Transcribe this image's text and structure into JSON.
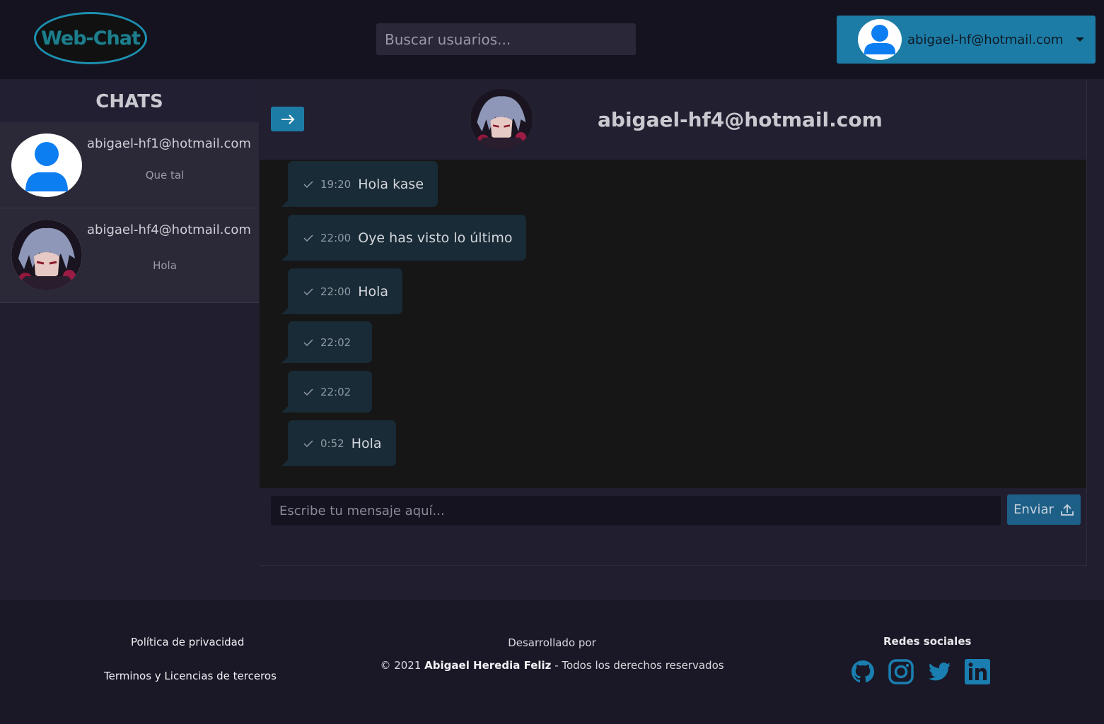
{
  "header": {
    "logo_text": "Web-Chat",
    "search_placeholder": "Buscar usuarios...",
    "account_email": "abigael-hf@hotmail.com"
  },
  "sidebar": {
    "title": "CHATS",
    "chats": [
      {
        "email": "abigael-hf1@hotmail.com",
        "last_message": "Que tal",
        "avatar": "default-user"
      },
      {
        "email": "abigael-hf4@hotmail.com",
        "last_message": "Hola",
        "avatar": "anime-character"
      }
    ]
  },
  "chat": {
    "contact_email": "abigael-hf4@hotmail.com",
    "messages": [
      {
        "time": "19:20",
        "text": "Hola kase"
      },
      {
        "time": "22:00",
        "text": "Oye has visto lo último"
      },
      {
        "time": "22:00",
        "text": "Hola"
      },
      {
        "time": "22:02",
        "text": ""
      },
      {
        "time": "22:02",
        "text": ""
      },
      {
        "time": "0:52",
        "text": "Hola"
      }
    ],
    "input_placeholder": "Escribe tu mensaje aquí...",
    "send_label": "Enviar"
  },
  "footer": {
    "privacy_link": "Política de privacidad",
    "terms_link": "Terminos y Licencias de terceros",
    "developed_by": "Desarrollado por",
    "copyright_prefix": "© 2021",
    "author": "Abigael Heredia Feliz",
    "copyright_suffix": "- Todos los derechos reservados",
    "social_title": "Redes sociales",
    "social_icons": [
      "github-icon",
      "instagram-icon",
      "twitter-icon",
      "linkedin-icon"
    ]
  },
  "colors": {
    "accent": "#1d7ca6",
    "bubble": "#182b36",
    "background": "#211e30"
  }
}
